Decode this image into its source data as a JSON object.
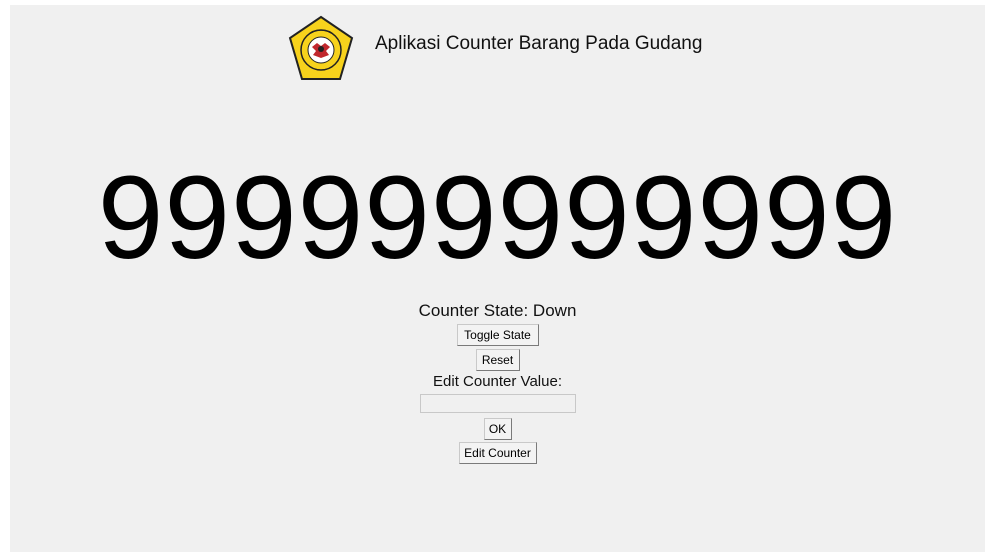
{
  "app": {
    "title": "Aplikasi Counter Barang Pada Gudang",
    "accent": "#f7d21c"
  },
  "counter": {
    "value": "999999999999"
  },
  "state": {
    "label": "Counter State: Down"
  },
  "buttons": {
    "toggle": "Toggle State",
    "reset": "Reset",
    "ok": "OK",
    "edit": "Edit Counter"
  },
  "edit": {
    "label": "Edit Counter Value:",
    "value": "",
    "placeholder": ""
  },
  "logo": {
    "icon": "university-seal-icon",
    "text_top": "UNIVERSITAS MERDEKA",
    "text_bottom": "MALANG"
  }
}
